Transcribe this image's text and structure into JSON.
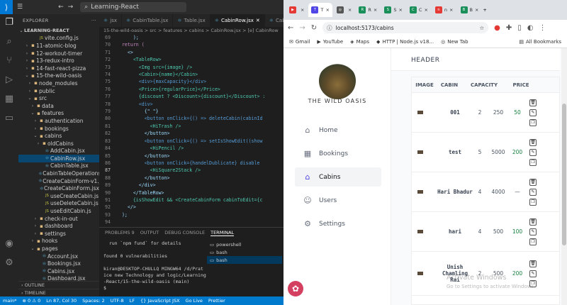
{
  "vscode": {
    "window_title": "Learning-React",
    "explorer_header": "EXPLORER",
    "root_folder": "LEARNING-REACT",
    "tree": [
      {
        "label": "vite.config.js",
        "type": "js",
        "indent": 5
      },
      {
        "label": "11-atomic-blog",
        "type": "folder",
        "indent": 2
      },
      {
        "label": "12-workout-timer",
        "type": "folder",
        "indent": 2
      },
      {
        "label": "13-redux-intro",
        "type": "folder",
        "indent": 2
      },
      {
        "label": "14-fast-react-pizza",
        "type": "folder",
        "indent": 2
      },
      {
        "label": "15-the-wild-oasis",
        "type": "folder-open",
        "indent": 2
      },
      {
        "label": "node_modules",
        "type": "folder",
        "indent": 3
      },
      {
        "label": "public",
        "type": "folder",
        "indent": 3
      },
      {
        "label": "src",
        "type": "folder-open",
        "indent": 3
      },
      {
        "label": "data",
        "type": "folder",
        "indent": 4
      },
      {
        "label": "features",
        "type": "folder-open",
        "indent": 4
      },
      {
        "label": "authentication",
        "type": "folder",
        "indent": 5
      },
      {
        "label": "bookings",
        "type": "folder",
        "indent": 5
      },
      {
        "label": "cabins",
        "type": "folder-open",
        "indent": 5
      },
      {
        "label": "oldCabins",
        "type": "folder",
        "indent": 6
      },
      {
        "label": "AddCabin.jsx",
        "type": "jsx",
        "indent": 7
      },
      {
        "label": "CabinRow.jsx",
        "type": "jsx",
        "indent": 7,
        "selected": true
      },
      {
        "label": "CabinTable.jsx",
        "type": "jsx",
        "indent": 7
      },
      {
        "label": "CabinTableOperations.jsx",
        "type": "jsx",
        "indent": 7
      },
      {
        "label": "CreateCabinForm-v1.jsx",
        "type": "jsx",
        "indent": 7
      },
      {
        "label": "CreateCabinForm.jsx",
        "type": "jsx",
        "indent": 7
      },
      {
        "label": "useCreateCabin.js",
        "type": "js",
        "indent": 7
      },
      {
        "label": "useDeleteCabin.js",
        "type": "js",
        "indent": 7
      },
      {
        "label": "useEditCabin.js",
        "type": "js",
        "indent": 7
      },
      {
        "label": "check-in-out",
        "type": "folder",
        "indent": 5
      },
      {
        "label": "dashboard",
        "type": "folder",
        "indent": 5
      },
      {
        "label": "settings",
        "type": "folder",
        "indent": 5
      },
      {
        "label": "hooks",
        "type": "folder",
        "indent": 4
      },
      {
        "label": "pages",
        "type": "folder-open",
        "indent": 4
      },
      {
        "label": "Account.jsx",
        "type": "jsx",
        "indent": 6
      },
      {
        "label": "Bookings.jsx",
        "type": "jsx",
        "indent": 6
      },
      {
        "label": "Cabins.jsx",
        "type": "jsx",
        "indent": 6
      },
      {
        "label": "Dashboard.jsx",
        "type": "jsx",
        "indent": 6
      }
    ],
    "outline_label": "OUTLINE",
    "timeline_label": "TIMELINE",
    "tabs": [
      {
        "label": "jsx",
        "active": false
      },
      {
        "label": "CabinTable.jsx",
        "active": false
      },
      {
        "label": "Table.jsx",
        "active": false
      },
      {
        "label": "CabinRow.jsx",
        "active": true
      },
      {
        "label": "CabinRow",
        "active": false
      }
    ],
    "breadcrumb": "15-the-wild-oasis > src > features > cabins > CabinRow.jsx > [e] CabinRow",
    "code_lines": [
      {
        "n": "69",
        "text": "      );"
      },
      {
        "n": "70",
        "text": "  return ("
      },
      {
        "n": "71",
        "text": "    <>"
      },
      {
        "n": "72",
        "text": "      <TableRow>"
      },
      {
        "n": "73",
        "text": "        <Img src={image} />"
      },
      {
        "n": "74",
        "text": "        <Cabin>{name}</Cabin>"
      },
      {
        "n": "75",
        "text": "        <div>{maxCapacity}</div>"
      },
      {
        "n": "76",
        "text": "        <Price>{regularPrice}</Price>"
      },
      {
        "n": "77",
        "text": "        {discount ? <Discount>{discount}</Discount> :"
      },
      {
        "n": "78",
        "text": "        <div>"
      },
      {
        "n": "79",
        "text": "          {\" \"}"
      },
      {
        "n": "80",
        "text": "          <button onClick={() => deleteCabin(cabinId"
      },
      {
        "n": "81",
        "text": "            <HiTrash />"
      },
      {
        "n": "82",
        "text": "          </button>"
      },
      {
        "n": "83",
        "text": "          <button onClick={() => setIsShowEdit((show"
      },
      {
        "n": "84",
        "text": "            <HiPencil />"
      },
      {
        "n": "85",
        "text": "          </button>"
      },
      {
        "n": "86",
        "text": "          <button onClick={handelDublicate} disable"
      },
      {
        "n": "87",
        "text": "            <HiSquare2Stack />",
        "current": true
      },
      {
        "n": "88",
        "text": "          </button>"
      },
      {
        "n": "89",
        "text": "        </div>"
      },
      {
        "n": "90",
        "text": "      </TableRow>"
      },
      {
        "n": "91",
        "text": "      {isShowEdit && <CreateCabinForm cabinToEdit={c"
      },
      {
        "n": "92",
        "text": "    </>"
      },
      {
        "n": "93",
        "text": "  );"
      },
      {
        "n": "94",
        "text": ""
      },
      {
        "n": "95",
        "text": ""
      },
      {
        "n": "96",
        "text": "export default CabinRow;"
      },
      {
        "n": "97",
        "text": ""
      }
    ],
    "panel_tabs": [
      "PROBLEMS 9",
      "OUTPUT",
      "DEBUG CONSOLE",
      "TERMINAL"
    ],
    "terminal_text": "  run `npm fund` for details\n\nfound 0 vulnerabilities\n\nkiran@DESKTOP-CHULLQ MINGW64 /d/Prat\nice new Technology and logic/Learning\n-React/15-the-wild-oasis (main)\n$ ",
    "terminal_list": [
      "powershell",
      "bash",
      "bash"
    ],
    "status_items": [
      "main*",
      "⊗ 0 ⚠ 0",
      "Ln 87, Col 30",
      "Spaces: 2",
      "UTF-8",
      "LF",
      "{} JavaScript JSX",
      "Go Live",
      "Prettier"
    ]
  },
  "browser": {
    "tabs": [
      {
        "label": "",
        "color": "#e53935",
        "glyph": "▶"
      },
      {
        "label": "T",
        "color": "#4f46e5",
        "glyph": "T",
        "active": true
      },
      {
        "label": "",
        "color": "#555",
        "glyph": "◎"
      },
      {
        "label": "R",
        "color": "#1a8f5a",
        "glyph": "R"
      },
      {
        "label": "S",
        "color": "#1a8f5a",
        "glyph": "S"
      },
      {
        "label": "C",
        "color": "#1a8f5a",
        "glyph": "C"
      },
      {
        "label": "n",
        "color": "#e53935",
        "glyph": "n"
      },
      {
        "label": "B",
        "color": "#1a8f5a",
        "glyph": "B"
      }
    ],
    "url": "localhost:5173/cabins",
    "bookmarks": [
      "Gmail",
      "YouTube",
      "Maps",
      "HTTP | Node.js v18...",
      "New Tab",
      "All Bookmarks"
    ]
  },
  "app": {
    "brand": "THE WILD OASIS",
    "header": "HEADER",
    "nav": [
      {
        "label": "Home",
        "icon": "⌂"
      },
      {
        "label": "Bookings",
        "icon": "▦"
      },
      {
        "label": "Cabins",
        "icon": "⌂",
        "active": true
      },
      {
        "label": "Users",
        "icon": "☺"
      },
      {
        "label": "Settings",
        "icon": "⚙"
      }
    ],
    "columns": [
      "IMAGE",
      "CABIN",
      "CAPACITY",
      "PRICE"
    ],
    "rows": [
      {
        "cabin": "001",
        "capacity": "2",
        "price": "250",
        "discount": "50"
      },
      {
        "cabin": "test",
        "capacity": "5",
        "price": "5000",
        "discount": "200"
      },
      {
        "cabin": "Hari Bhadur",
        "capacity": "4",
        "price": "4000",
        "discount": "—"
      },
      {
        "cabin": "hari",
        "capacity": "4",
        "price": "500",
        "discount": "100"
      },
      {
        "cabin": "Unish Chamling Rai",
        "capacity": "2",
        "price": "500",
        "discount": "200"
      }
    ],
    "watermark_title": "Activate Windows",
    "watermark_sub": "Go to Settings to activate Windows."
  }
}
